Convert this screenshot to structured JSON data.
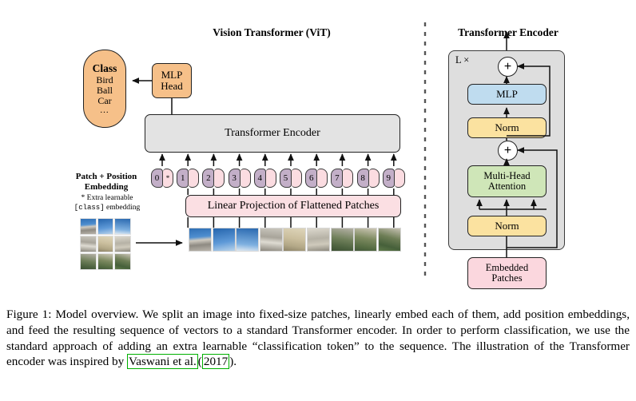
{
  "figure": {
    "left_panel_title": "Vision Transformer (ViT)",
    "right_panel_title": "Transformer Encoder"
  },
  "left_panel": {
    "class_box": {
      "title": "Class",
      "items": [
        "Bird",
        "Ball",
        "Car"
      ],
      "ellipsis": "...",
      "color": "#f6c089"
    },
    "mlp_head": {
      "line1": "MLP",
      "line2": "Head",
      "color": "#f6c089"
    },
    "transformer_encoder_box": {
      "label": "Transformer Encoder",
      "color": "#e3e3e3"
    },
    "linear_projection_box": {
      "label": "Linear Projection of Flattened Patches",
      "color": "#fbdfe3"
    },
    "patch_position_label": {
      "line1": "Patch + Position",
      "line2": "Embedding"
    },
    "extra_learnable_note": {
      "prefix": "* Extra learnable",
      "mono_token": "[class]",
      "suffix": "embedding"
    },
    "tokens": [
      {
        "number": "0",
        "patch_mark": "*"
      },
      {
        "number": "1",
        "patch_mark": ""
      },
      {
        "number": "2",
        "patch_mark": ""
      },
      {
        "number": "3",
        "patch_mark": ""
      },
      {
        "number": "4",
        "patch_mark": ""
      },
      {
        "number": "5",
        "patch_mark": ""
      },
      {
        "number": "6",
        "patch_mark": ""
      },
      {
        "number": "7",
        "patch_mark": ""
      },
      {
        "number": "8",
        "patch_mark": ""
      },
      {
        "number": "9",
        "patch_mark": ""
      }
    ],
    "token_colors": {
      "number": "#c3afc8",
      "patch": "#fbdce1"
    },
    "source_image_patch_count": 9,
    "flattened_patch_count": 9
  },
  "right_panel": {
    "repeat_label": "L ×",
    "container_color": "#dedede",
    "blocks": [
      {
        "name": "add-top",
        "label": "+"
      },
      {
        "name": "mlp",
        "label": "MLP",
        "color": "#bfdcef"
      },
      {
        "name": "norm-top",
        "label": "Norm",
        "color": "#fbe2a0"
      },
      {
        "name": "add-bottom",
        "label": "+"
      },
      {
        "name": "multi-head-attention",
        "line1": "Multi-Head",
        "line2": "Attention",
        "color": "#cfe6b8"
      },
      {
        "name": "norm-bottom",
        "label": "Norm",
        "color": "#fbe2a0"
      }
    ],
    "embedded_patches": {
      "line1": "Embedded",
      "line2": "Patches",
      "color": "#fbd7de"
    }
  },
  "caption": {
    "part1": "Figure 1: Model overview. We split an image into fixed-size patches, linearly embed each of them, add position embeddings, and feed the resulting sequence of vectors to a standard Transformer encoder. In order to perform classification, we use the standard approach of adding an extra learnable “classification token” to the sequence. The illustration of the Transformer encoder was inspired by ",
    "cite_author": "Vaswani et al.",
    "cite_open": "(",
    "cite_year": "2017",
    "cite_close": ")",
    "part2": ".",
    "citation_box_color": "#00b000"
  }
}
